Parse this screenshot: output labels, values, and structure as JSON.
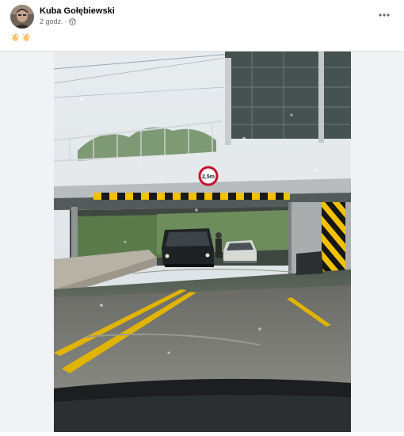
{
  "post": {
    "author": "Kuba Gołębiewski",
    "time": "2 godz.",
    "separator": "·",
    "privacy_icon": "globe-icon",
    "more_icon": "more-horizontal-icon",
    "caption_icons": [
      "clapping-hands-icon",
      "clapping-hands-icon"
    ]
  },
  "photo": {
    "sign_text": "2,5m",
    "description_icon": "flooded-underpass-photo"
  },
  "colors": {
    "name": "#050505",
    "meta": "#65676b",
    "media_bg": "#f0f2f5",
    "hazard_yellow": "#f2c200",
    "road_line": "#e0b400"
  }
}
